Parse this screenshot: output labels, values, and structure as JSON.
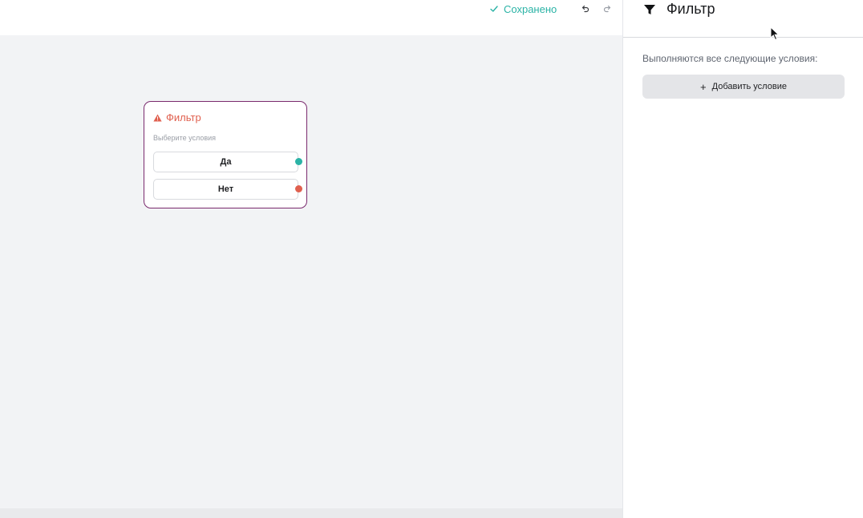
{
  "topbar": {
    "saved_label": "Сохранено",
    "saved_icon": "check-icon",
    "undo_icon": "undo-icon",
    "redo_icon": "redo-icon"
  },
  "node": {
    "title": "Фильтр",
    "title_icon": "warning-icon",
    "subtitle": "Выберите условия",
    "branches": [
      {
        "label": "Да",
        "port_color": "#2bb3a6"
      },
      {
        "label": "Нет",
        "port_color": "#e0604f"
      }
    ],
    "border_color": "#7a2a6e"
  },
  "panel": {
    "icon": "filter-icon",
    "title": "Фильтр",
    "condition_text": "Выполняются все следующие условия:",
    "add_condition": {
      "icon": "plus-icon",
      "label": "Добавить условие"
    }
  },
  "colors": {
    "accent_teal": "#2bb3a6",
    "accent_red": "#e0604f",
    "canvas_bg": "#f2f3f5"
  }
}
